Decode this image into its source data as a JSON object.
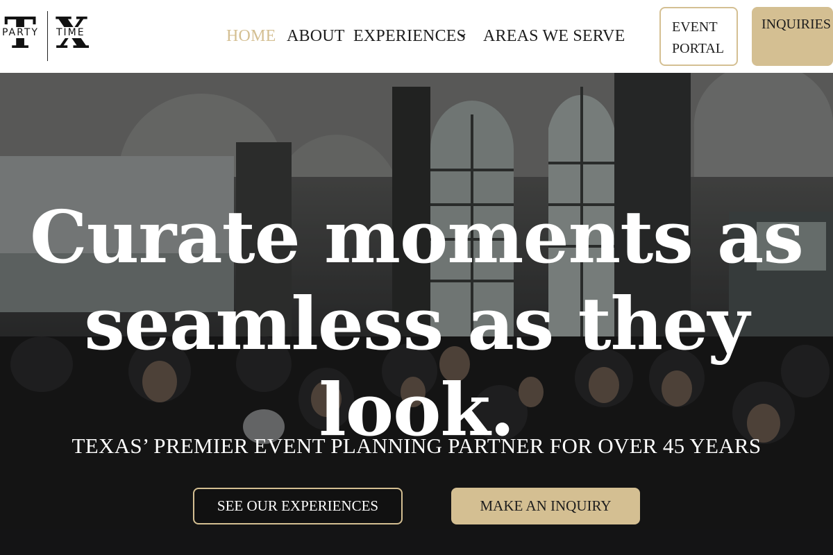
{
  "logo": {
    "letter_left": "T",
    "letter_right": "X",
    "word_left": "PARTY",
    "word_right": "TIME"
  },
  "nav": {
    "items": [
      {
        "label": "HOME",
        "active": true
      },
      {
        "label": "ABOUT"
      },
      {
        "label": "EXPERIENCES",
        "has_dropdown": true
      },
      {
        "label": "AREAS WE SERVE"
      }
    ]
  },
  "header_buttons": {
    "event_portal_line1": "EVENT",
    "event_portal_line2": "PORTAL",
    "inquiries": "INQUIRIES"
  },
  "hero": {
    "headline_line1": "Curate moments as",
    "headline_line2": "seamless as they look.",
    "tagline": "TEXAS’ PREMIER EVENT PLANNING PARTNER FOR OVER 45 YEARS",
    "primary_cta": "SEE OUR EXPERIENCES",
    "secondary_cta": "MAKE AN INQUIRY"
  },
  "colors": {
    "accent_gold": "#d4bf92",
    "text_dark": "#1d1d1d",
    "active_nav": "#d4bf92"
  },
  "icons": {
    "dropdown": "chevron-down-icon"
  }
}
